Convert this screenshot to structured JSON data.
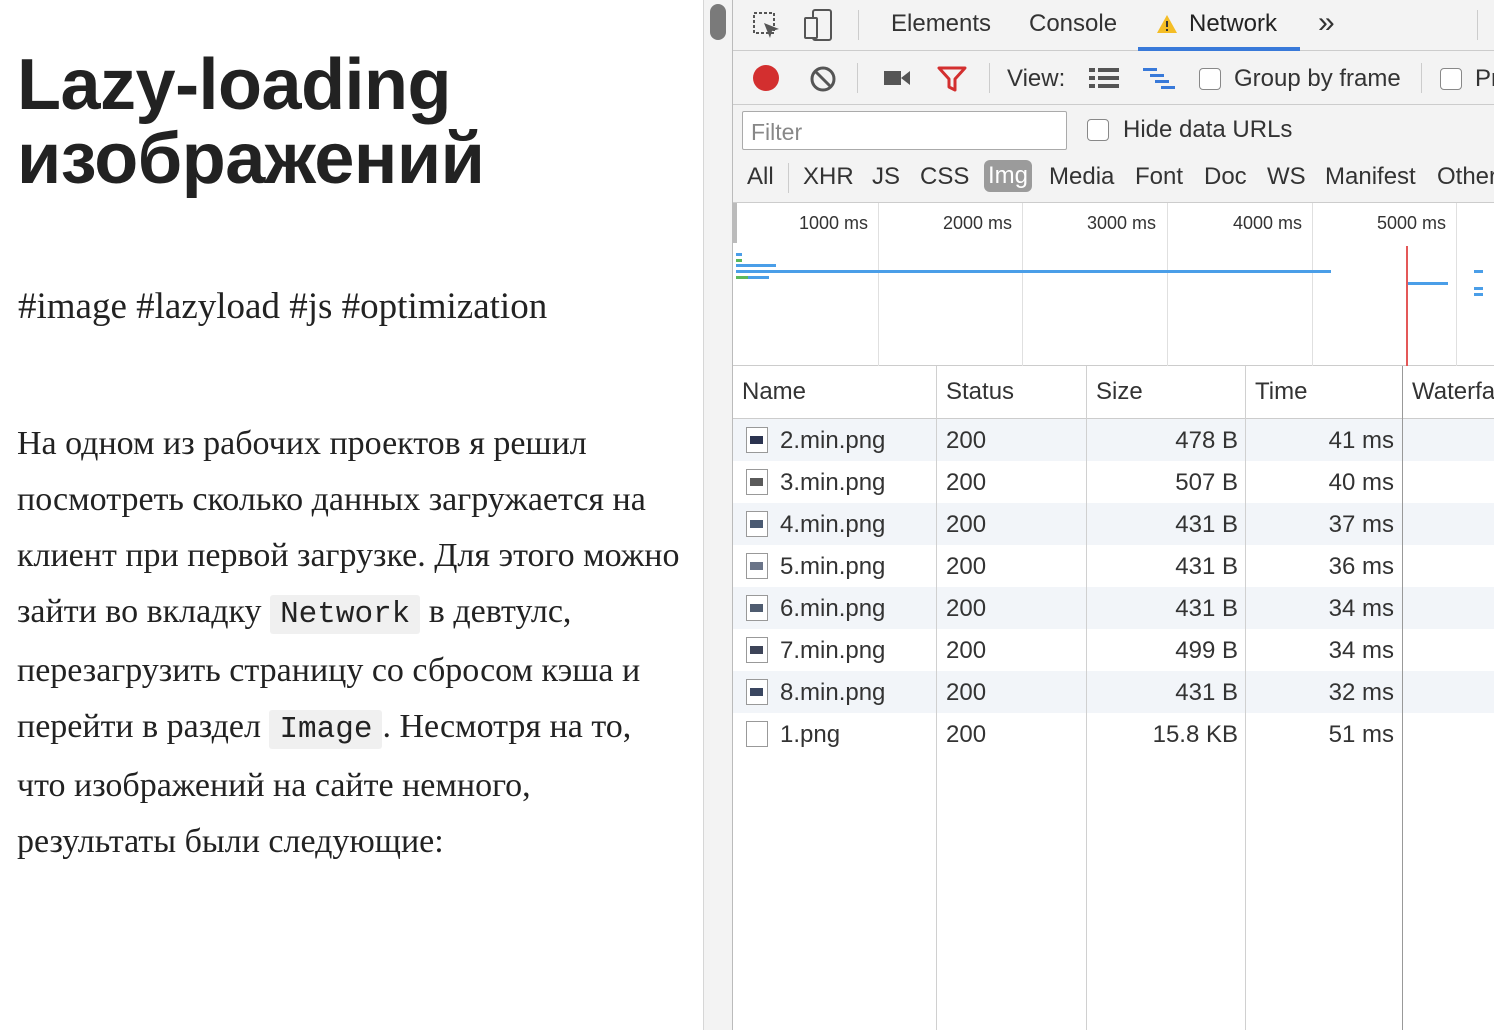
{
  "article": {
    "title_line1": "Lazy-loading",
    "title_line2": "изображений",
    "tags": [
      "#image",
      "#lazyload",
      "#js",
      "#optimization"
    ],
    "body_part1": "На одном из рабочих проектов я решил посмотреть сколько данных загружается на клиент при первой загрузке. Для этого можно зайти во вкладку ",
    "code1": "Network",
    "body_part2": " в девтулс, перезагрузить страницу со сбросом кэша и перейти в раздел ",
    "code2": "Image",
    "body_part3": ". Несмотря на то, что изображений на сайте немного, результаты были следующие:"
  },
  "devtools": {
    "tabs": {
      "elements": "Elements",
      "console": "Console",
      "network": "Network",
      "more": "»"
    },
    "toolbar": {
      "view_label": "View:",
      "group_by_frame": "Group by frame",
      "preserve_cut": "Pr"
    },
    "filter": {
      "placeholder": "Filter",
      "hide_data_urls": "Hide data URLs",
      "types": [
        "All",
        "XHR",
        "JS",
        "CSS",
        "Img",
        "Media",
        "Font",
        "Doc",
        "WS",
        "Manifest",
        "Other"
      ],
      "active_type": "Img"
    },
    "overview": {
      "ticks": [
        "1000 ms",
        "2000 ms",
        "3000 ms",
        "4000 ms",
        "5000 ms"
      ],
      "colors": {
        "waiting": "#5cb85c",
        "download": "#4a9ee8",
        "load_marker": "#e45858"
      }
    },
    "table": {
      "headers": {
        "name": "Name",
        "status": "Status",
        "size": "Size",
        "time": "Time",
        "waterfall": "Waterfa"
      },
      "rows": [
        {
          "name": "2.min.png",
          "status": "200",
          "size": "478 B",
          "time": "41 ms"
        },
        {
          "name": "3.min.png",
          "status": "200",
          "size": "507 B",
          "time": "40 ms"
        },
        {
          "name": "4.min.png",
          "status": "200",
          "size": "431 B",
          "time": "37 ms"
        },
        {
          "name": "5.min.png",
          "status": "200",
          "size": "431 B",
          "time": "36 ms"
        },
        {
          "name": "6.min.png",
          "status": "200",
          "size": "431 B",
          "time": "34 ms"
        },
        {
          "name": "7.min.png",
          "status": "200",
          "size": "499 B",
          "time": "34 ms"
        },
        {
          "name": "8.min.png",
          "status": "200",
          "size": "431 B",
          "time": "32 ms"
        },
        {
          "name": "1.png",
          "status": "200",
          "size": "15.8 KB",
          "time": "51 ms"
        }
      ]
    }
  }
}
